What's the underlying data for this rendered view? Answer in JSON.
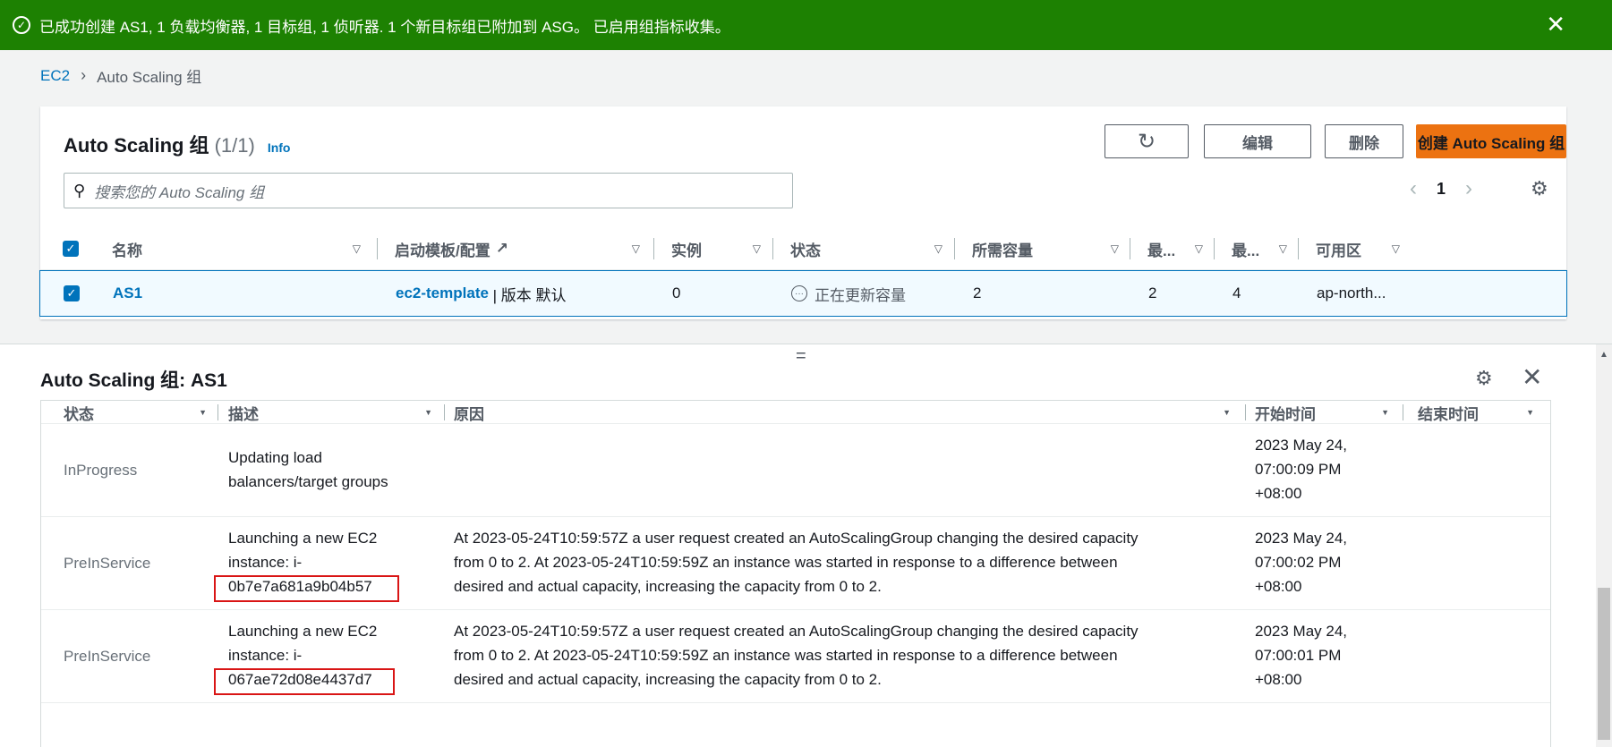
{
  "flash": {
    "message": "已成功创建 AS1, 1 负载均衡器, 1 目标组, 1 侦听器. 1 个新目标组已附加到 ASG。 已启用组指标收集。",
    "close": "✕"
  },
  "breadcrumb": {
    "root": "EC2",
    "current": "Auto Scaling 组"
  },
  "panel": {
    "title": "Auto Scaling 组",
    "count": "(1/1)",
    "info": "Info",
    "buttons": {
      "refresh": "↻",
      "edit": "编辑",
      "delete": "删除",
      "create": "创建 Auto Scaling 组"
    },
    "search_placeholder": "搜索您的 Auto Scaling 组",
    "page": "1",
    "columns": [
      "名称",
      "启动模板/配置",
      "实例",
      "状态",
      "所需容量",
      "最...",
      "最...",
      "可用区"
    ],
    "row": {
      "name": "AS1",
      "template": "ec2-template",
      "template_suffix": " | 版本 默认",
      "instances": "0",
      "status": "正在更新容量",
      "desired": "2",
      "min": "2",
      "max": "4",
      "az": "ap-north..."
    }
  },
  "split": {
    "title": "Auto Scaling 组: AS1",
    "columns": [
      "状态",
      "描述",
      "原因",
      "开始时间",
      "结束时间"
    ],
    "rows": [
      {
        "state": "InProgress",
        "desc": [
          "Updating load",
          "balancers/target groups"
        ],
        "cause": [],
        "start": [
          "2023 May 24,",
          "07:00:09 PM",
          "+08:00"
        ]
      },
      {
        "state": "PreInService",
        "desc": [
          "Launching a new EC2",
          "instance: i-",
          "0b7e7a681a9b04b57"
        ],
        "cause": [
          "At 2023-05-24T10:59:57Z a user request created an AutoScalingGroup changing the desired capacity",
          "from 0 to 2. At 2023-05-24T10:59:59Z an instance was started in response to a difference between",
          "desired and actual capacity, increasing the capacity from 0 to 2."
        ],
        "start": [
          "2023 May 24,",
          "07:00:02 PM",
          "+08:00"
        ]
      },
      {
        "state": "PreInService",
        "desc": [
          "Launching a new EC2",
          "instance: i-",
          "067ae72d08e4437d7"
        ],
        "cause": [
          "At 2023-05-24T10:59:57Z a user request created an AutoScalingGroup changing the desired capacity",
          "from 0 to 2. At 2023-05-24T10:59:59Z an instance was started in response to a difference between",
          "desired and actual capacity, increasing the capacity from 0 to 2."
        ],
        "start": [
          "2023 May 24,",
          "07:00:01 PM",
          "+08:00"
        ]
      }
    ]
  },
  "colors": {
    "success": "#1d8102",
    "link": "#0073bb",
    "primary": "#ec7211",
    "highlight": "#d91515"
  }
}
